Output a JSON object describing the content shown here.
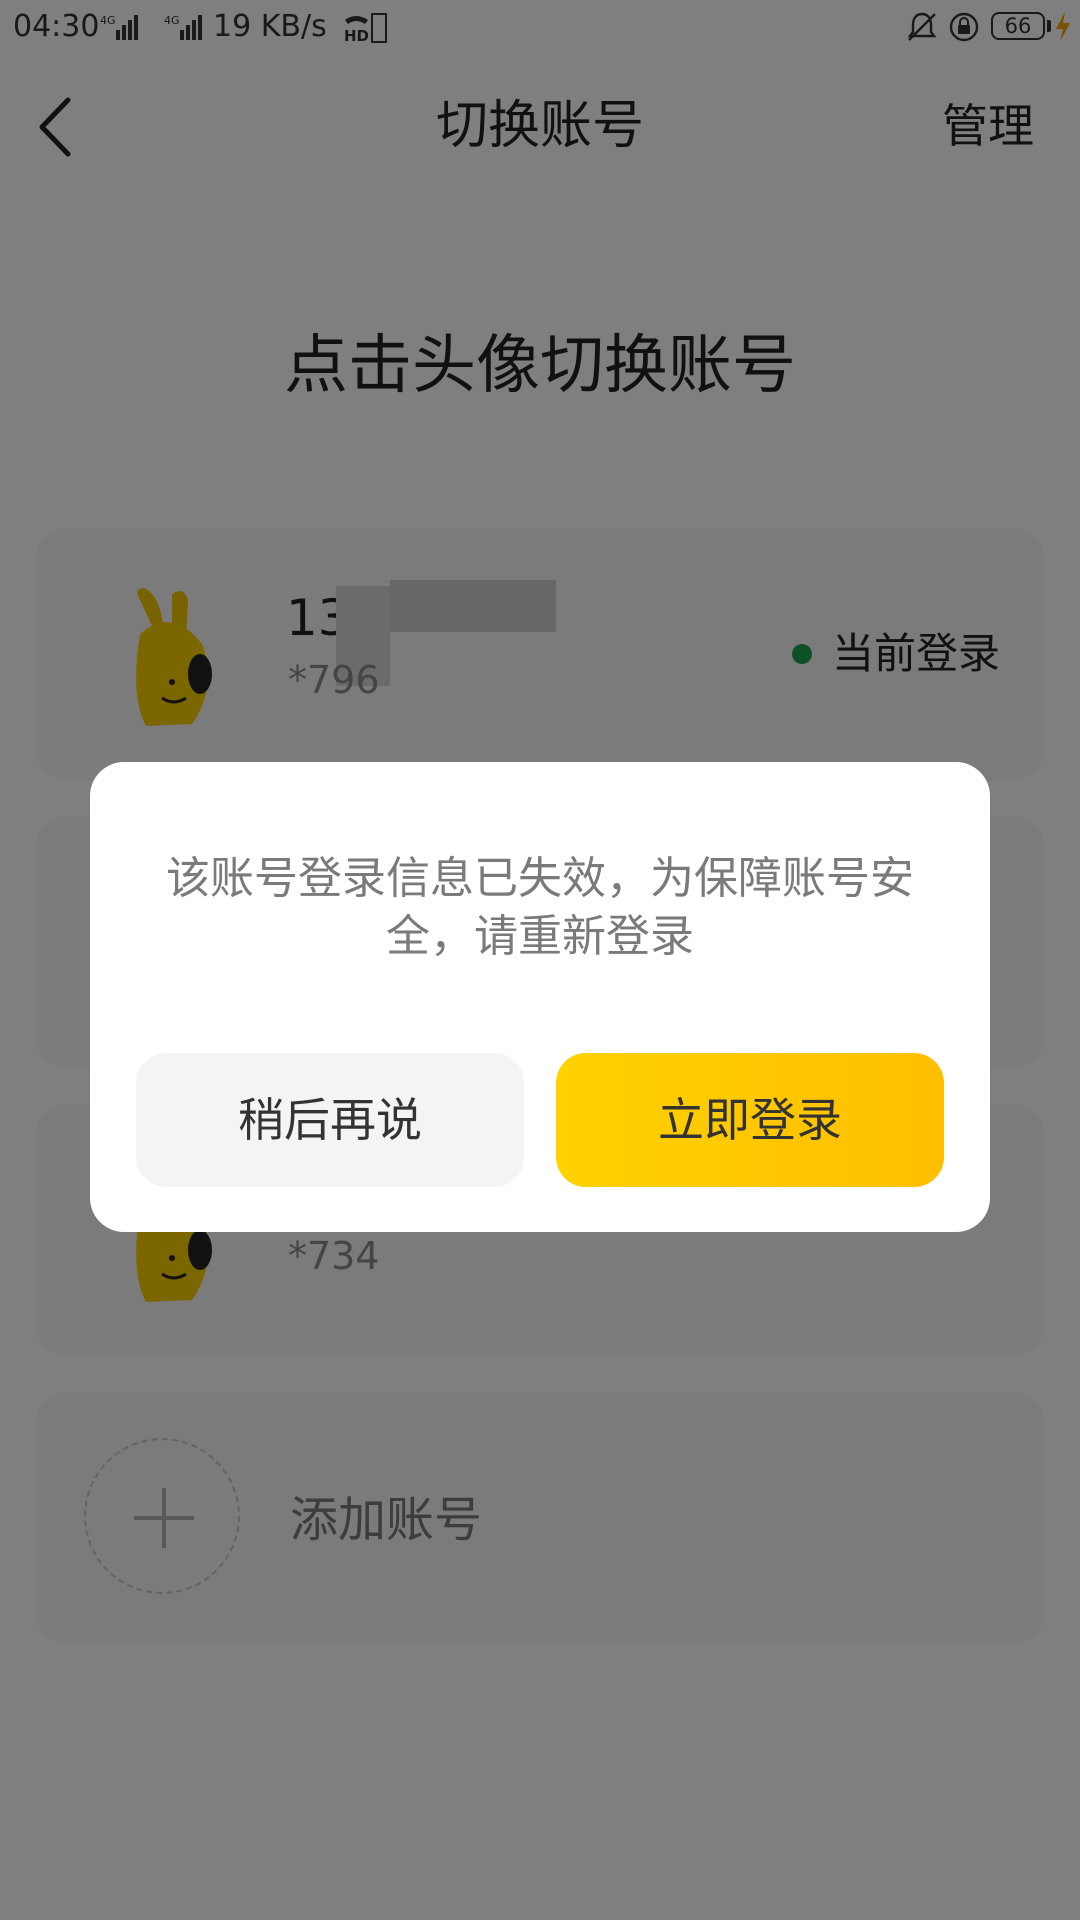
{
  "status_bar": {
    "time": "04:30",
    "network_speed": "19 KB/s",
    "battery": "66"
  },
  "header": {
    "title": "切换账号",
    "manage_label": "管理"
  },
  "content": {
    "hint": "点击头像切换账号",
    "accounts": [
      {
        "phone": "130",
        "suffix": "*796",
        "status": "当前登录"
      },
      {
        "phone": "",
        "suffix": "*734",
        "status": ""
      }
    ],
    "add_account_label": "添加账号"
  },
  "dialog": {
    "message": "该账号登录信息已失效，为保障账号安全，请重新登录",
    "later_label": "稍后再说",
    "login_label": "立即登录"
  },
  "colors": {
    "accent": "#FFC800",
    "status_dot": "#16A34A",
    "overlay": "rgba(0,0,0,0.5)"
  }
}
